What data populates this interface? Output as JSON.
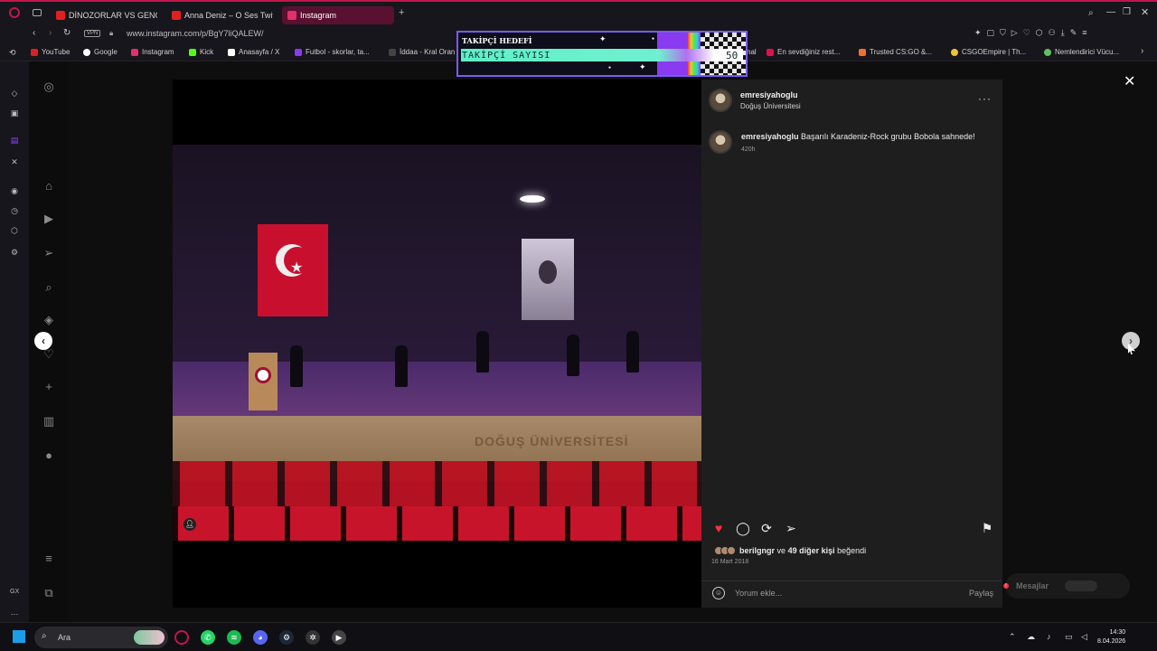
{
  "browser": {
    "tabs": [
      {
        "label": "DİNOZORLAR VS GENÇLE",
        "icon": "youtube-icon",
        "color": "#e02020"
      },
      {
        "label": "Anna Deniz – O Ses Twitc",
        "icon": "youtube-icon",
        "color": "#e02020"
      },
      {
        "label": "Instagram",
        "icon": "instagram-icon",
        "color": "#e1306c"
      }
    ],
    "vpn_label": "VPN",
    "url": "www.instagram.com/p/BgY7liQALEW/",
    "bookmarks": [
      {
        "label": "YouTube",
        "color": "#e02020"
      },
      {
        "label": "Google",
        "color": "#ffffff"
      },
      {
        "label": "Instagram",
        "color": "#e1306c"
      },
      {
        "label": "Kick",
        "color": "#53fc18"
      },
      {
        "label": "Anasayfa / X",
        "color": "#ffffff"
      },
      {
        "label": "Futbol - skorlar, ta...",
        "color": "#8a3af0"
      },
      {
        "label": "İddaa - Kral Oran",
        "color": "#444444"
      },
      {
        "label": "En sevdiğiniz rest...",
        "color": "#e01050"
      },
      {
        "label": "Trusted CS:GO &...",
        "color": "#f07030"
      },
      {
        "label": "CSGOEmpire | Th...",
        "color": "#f0c040"
      },
      {
        "label": "Nemlendirici Vücu...",
        "color": "#60c060"
      }
    ],
    "bookmark_cut_label": "nal"
  },
  "widget": {
    "title": "TAKİPÇİ HEDEFİ",
    "label": "TAKİPÇİ SAYISI",
    "goal": "50"
  },
  "post": {
    "username": "emresiyahoglu",
    "location": "Doğuş Üniversitesi",
    "caption_user": "emresiyahoglu",
    "caption_text": "Başarılı Karadeniz-Rock grubu Bobola sahnede!",
    "age": "420h",
    "liked_by": "berilgngr",
    "likes_mid": "ve",
    "likes_count": "49 diğer kişi",
    "likes_suffix": "beğendi",
    "date": "16 Mart 2018",
    "comment_placeholder": "Yorum ekle...",
    "share_label": "Paylaş",
    "stage_text": "DOĞUŞ ÜNİVERSİTESİ",
    "messages_label": "Mesajlar",
    "messages_badge": "!"
  },
  "taskbar": {
    "search_label": "Ara",
    "time": "14:30",
    "date": "8.04.2026"
  },
  "opera_sidebar": {
    "gx_label": "GX"
  }
}
